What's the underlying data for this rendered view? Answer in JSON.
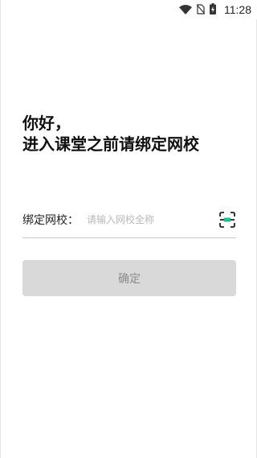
{
  "status_bar": {
    "time": "11:28",
    "icons": [
      "wifi-icon",
      "no-sim-icon",
      "battery-charging-icon"
    ]
  },
  "greeting": {
    "line1": "你好，",
    "line2": "进入课堂之前请绑定网校"
  },
  "school_field": {
    "label": "绑定网校：",
    "placeholder": "请输入网校全称",
    "value": ""
  },
  "scan": {
    "icon": "scan-icon",
    "accent_color": "#1dc48a"
  },
  "confirm": {
    "label": "确定"
  },
  "colors": {
    "button_disabled_bg": "#d9d9d9",
    "button_disabled_text": "#8a8a8a"
  }
}
